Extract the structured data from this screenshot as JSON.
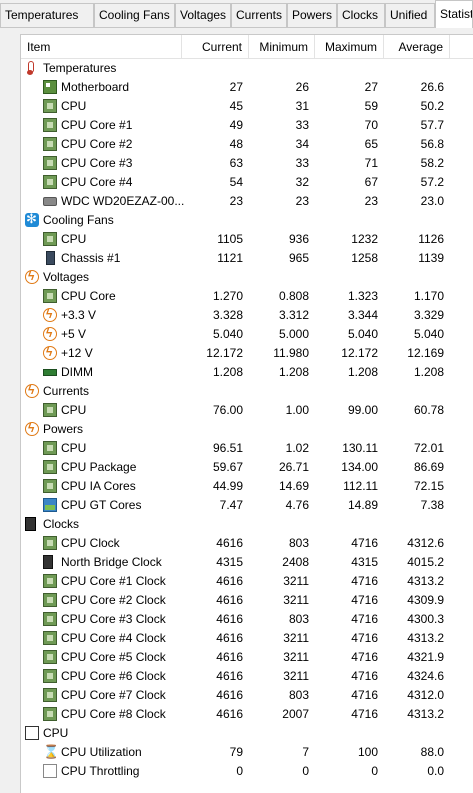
{
  "tabs": [
    "Temperatures",
    "Cooling Fans",
    "Voltages",
    "Currents",
    "Powers",
    "Clocks",
    "Unified",
    "Statist"
  ],
  "active_tab": "Statist",
  "columns": {
    "item": "Item",
    "current": "Current",
    "minimum": "Minimum",
    "maximum": "Maximum",
    "average": "Average"
  },
  "rows": [
    {
      "type": "category",
      "icon": "thermometer-icon",
      "label": "Temperatures"
    },
    {
      "type": "sensor",
      "icon": "motherboard-icon",
      "label": "Motherboard",
      "current": "27",
      "minimum": "26",
      "maximum": "27",
      "average": "26.6"
    },
    {
      "type": "sensor",
      "icon": "chip-icon",
      "label": "CPU",
      "current": "45",
      "minimum": "31",
      "maximum": "59",
      "average": "50.2"
    },
    {
      "type": "sensor",
      "icon": "chip-icon",
      "label": "CPU Core #1",
      "current": "49",
      "minimum": "33",
      "maximum": "70",
      "average": "57.7"
    },
    {
      "type": "sensor",
      "icon": "chip-icon",
      "label": "CPU Core #2",
      "current": "48",
      "minimum": "34",
      "maximum": "65",
      "average": "56.8"
    },
    {
      "type": "sensor",
      "icon": "chip-icon",
      "label": "CPU Core #3",
      "current": "63",
      "minimum": "33",
      "maximum": "71",
      "average": "58.2"
    },
    {
      "type": "sensor",
      "icon": "chip-icon",
      "label": "CPU Core #4",
      "current": "54",
      "minimum": "32",
      "maximum": "67",
      "average": "57.2"
    },
    {
      "type": "sensor",
      "icon": "hard-drive-icon",
      "label": "WDC WD20EZAZ-00...",
      "current": "23",
      "minimum": "23",
      "maximum": "23",
      "average": "23.0"
    },
    {
      "type": "category",
      "icon": "fan-icon",
      "label": "Cooling Fans"
    },
    {
      "type": "sensor",
      "icon": "chip-icon",
      "label": "CPU",
      "current": "1105",
      "minimum": "936",
      "maximum": "1232",
      "average": "1126"
    },
    {
      "type": "sensor",
      "icon": "case-icon",
      "label": "Chassis #1",
      "current": "1121",
      "minimum": "965",
      "maximum": "1258",
      "average": "1139"
    },
    {
      "type": "category",
      "icon": "bolt-icon",
      "label": "Voltages"
    },
    {
      "type": "sensor",
      "icon": "chip-icon",
      "label": "CPU Core",
      "current": "1.270",
      "minimum": "0.808",
      "maximum": "1.323",
      "average": "1.170"
    },
    {
      "type": "sensor",
      "icon": "bolt-icon",
      "label": "+3.3 V",
      "current": "3.328",
      "minimum": "3.312",
      "maximum": "3.344",
      "average": "3.329"
    },
    {
      "type": "sensor",
      "icon": "bolt-icon",
      "label": "+5 V",
      "current": "5.040",
      "minimum": "5.000",
      "maximum": "5.040",
      "average": "5.040"
    },
    {
      "type": "sensor",
      "icon": "bolt-icon",
      "label": "+12 V",
      "current": "12.172",
      "minimum": "11.980",
      "maximum": "12.172",
      "average": "12.169"
    },
    {
      "type": "sensor",
      "icon": "dimm-icon",
      "label": "DIMM",
      "current": "1.208",
      "minimum": "1.208",
      "maximum": "1.208",
      "average": "1.208"
    },
    {
      "type": "category",
      "icon": "bolt-icon",
      "label": "Currents"
    },
    {
      "type": "sensor",
      "icon": "chip-icon",
      "label": "CPU",
      "current": "76.00",
      "minimum": "1.00",
      "maximum": "99.00",
      "average": "60.78"
    },
    {
      "type": "category",
      "icon": "bolt-icon",
      "label": "Powers"
    },
    {
      "type": "sensor",
      "icon": "chip-icon",
      "label": "CPU",
      "current": "96.51",
      "minimum": "1.02",
      "maximum": "130.11",
      "average": "72.01"
    },
    {
      "type": "sensor",
      "icon": "chip-icon",
      "label": "CPU Package",
      "current": "59.67",
      "minimum": "26.71",
      "maximum": "134.00",
      "average": "86.69"
    },
    {
      "type": "sensor",
      "icon": "chip-icon",
      "label": "CPU IA Cores",
      "current": "44.99",
      "minimum": "14.69",
      "maximum": "112.11",
      "average": "72.15"
    },
    {
      "type": "sensor",
      "icon": "gpu-icon",
      "label": "CPU GT Cores",
      "current": "7.47",
      "minimum": "4.76",
      "maximum": "14.89",
      "average": "7.38"
    },
    {
      "type": "category",
      "icon": "clock-chip-icon",
      "label": "Clocks"
    },
    {
      "type": "sensor",
      "icon": "chip-icon",
      "label": "CPU Clock",
      "current": "4616",
      "minimum": "803",
      "maximum": "4716",
      "average": "4312.6"
    },
    {
      "type": "sensor",
      "icon": "northbridge-icon",
      "label": "North Bridge Clock",
      "current": "4315",
      "minimum": "2408",
      "maximum": "4315",
      "average": "4015.2"
    },
    {
      "type": "sensor",
      "icon": "chip-icon",
      "label": "CPU Core #1 Clock",
      "current": "4616",
      "minimum": "3211",
      "maximum": "4716",
      "average": "4313.2"
    },
    {
      "type": "sensor",
      "icon": "chip-icon",
      "label": "CPU Core #2 Clock",
      "current": "4616",
      "minimum": "3211",
      "maximum": "4716",
      "average": "4309.9"
    },
    {
      "type": "sensor",
      "icon": "chip-icon",
      "label": "CPU Core #3 Clock",
      "current": "4616",
      "minimum": "803",
      "maximum": "4716",
      "average": "4300.3"
    },
    {
      "type": "sensor",
      "icon": "chip-icon",
      "label": "CPU Core #4 Clock",
      "current": "4616",
      "minimum": "3211",
      "maximum": "4716",
      "average": "4313.2"
    },
    {
      "type": "sensor",
      "icon": "chip-icon",
      "label": "CPU Core #5 Clock",
      "current": "4616",
      "minimum": "3211",
      "maximum": "4716",
      "average": "4321.9"
    },
    {
      "type": "sensor",
      "icon": "chip-icon",
      "label": "CPU Core #6 Clock",
      "current": "4616",
      "minimum": "3211",
      "maximum": "4716",
      "average": "4324.6"
    },
    {
      "type": "sensor",
      "icon": "chip-icon",
      "label": "CPU Core #7 Clock",
      "current": "4616",
      "minimum": "803",
      "maximum": "4716",
      "average": "4312.0"
    },
    {
      "type": "sensor",
      "icon": "chip-icon",
      "label": "CPU Core #8 Clock",
      "current": "4616",
      "minimum": "2007",
      "maximum": "4716",
      "average": "4313.2"
    },
    {
      "type": "category",
      "icon": "cpu-outline-icon",
      "label": "CPU"
    },
    {
      "type": "sensor",
      "icon": "hourglass-icon",
      "label": "CPU Utilization",
      "current": "79",
      "minimum": "7",
      "maximum": "100",
      "average": "88.0"
    },
    {
      "type": "sensor",
      "icon": "blank-icon",
      "label": "CPU Throttling",
      "current": "0",
      "minimum": "0",
      "maximum": "0",
      "average": "0.0"
    }
  ]
}
